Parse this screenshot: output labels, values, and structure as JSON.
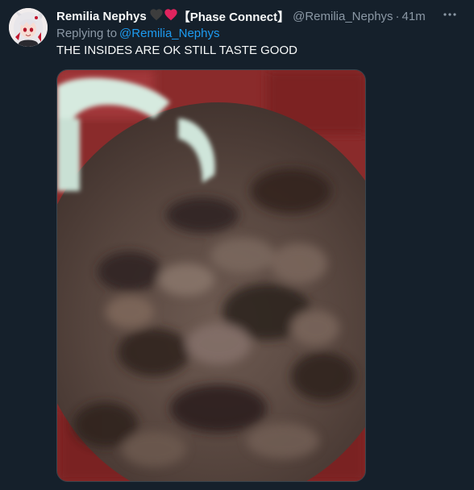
{
  "tweet": {
    "display_name": "Remilia Nephys",
    "name_suffix": "【Phase Connect】",
    "handle": "@Remilia_Nephys",
    "separator": "·",
    "time": "41m",
    "more_label": "···",
    "replying_prefix": "Replying to",
    "replying_to": "@Remilia_Nephys",
    "text": "THE INSIDES ARE OK STILL TASTE GOOD"
  },
  "icons": {
    "hearts": [
      "black-heart-icon",
      "red-heart-icon"
    ],
    "more": "more-options-icon"
  },
  "colors": {
    "background": "#15202b",
    "primary_text": "#f7f9f9",
    "secondary_text": "#8b98a5",
    "link": "#1d9bf0",
    "red_heart": "#e0245e"
  }
}
